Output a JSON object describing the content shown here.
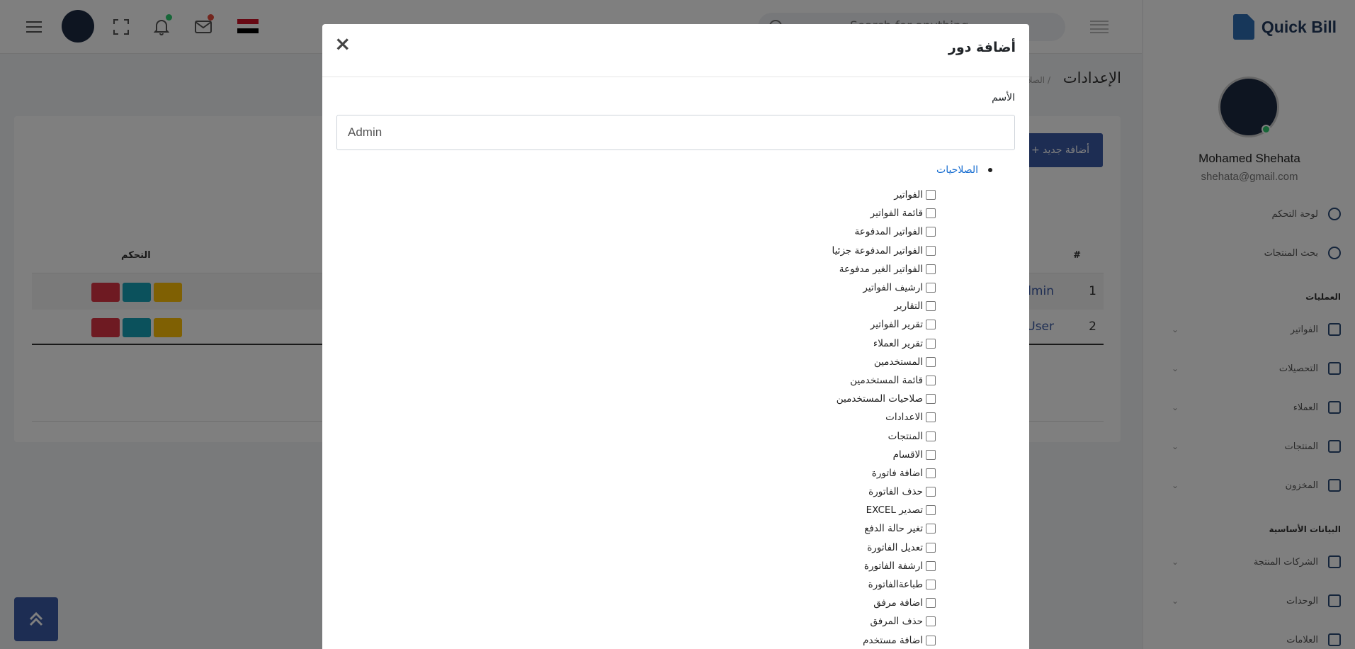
{
  "topbar": {
    "search_placeholder": "Search for anything...",
    "search_visible_text": "Search for anything"
  },
  "sidebar": {
    "brand": "Quick Bill",
    "user_name": "Mohamed Shehata",
    "user_email": "shehata@gmail.com",
    "items": [
      {
        "label": "لوحة التحكم"
      },
      {
        "label": "بحث المنتجات"
      }
    ],
    "sections": [
      {
        "title": "العمليات",
        "items": [
          "الفواتير",
          "التحصيلات",
          "العملاء",
          "المنتجات",
          "المخزون"
        ]
      },
      {
        "title": "البيانات الأساسية",
        "items": [
          "الشركات المنتجة",
          "الوحدات",
          "العلامات"
        ]
      }
    ]
  },
  "page": {
    "title": "الإعدادات",
    "breadcrumb": "/ الصلاحيات",
    "add_button": "أضافة جديد",
    "table": {
      "columns": [
        "#",
        "التحكم"
      ],
      "rows": [
        {
          "num": "1",
          "name": "Admin"
        },
        {
          "num": "2",
          "name": "User"
        }
      ]
    }
  },
  "modal": {
    "title": "أضافة دور",
    "close_label": "×",
    "name_label": "الأسم",
    "name_value": "Admin",
    "permissions_root": "الصلاحيات",
    "permissions": [
      "الفواتير",
      "قائمة الفواتير",
      "الفواتير المدفوعة",
      "الفواتير المدفوعة جزئيا",
      "الفواتير الغير مدفوعة",
      "ارشيف الفواتير",
      "التقارير",
      "تقرير الفواتير",
      "تقرير العملاء",
      "المستخدمين",
      "قائمة المستخدمين",
      "صلاحيات المستخدمين",
      "الاعدادات",
      "المنتجات",
      "الاقسام",
      "اضافة فاتورة",
      "حذف الفاتورة",
      "تصدير EXCEL",
      "تغير حالة الدفع",
      "تعديل الفاتورة",
      "ارشفة الفاتورة",
      "طباعةالفاتورة",
      "اضافة مرفق",
      "حذف المرفق",
      "اضافة مستخدم"
    ]
  },
  "colors": {
    "primary": "#3b5aa6",
    "danger": "#dc3545",
    "info": "#17a2b8",
    "warning": "#ffc107",
    "link": "#1a6fd1",
    "overlay": "rgba(0,0,0,0.5)"
  }
}
